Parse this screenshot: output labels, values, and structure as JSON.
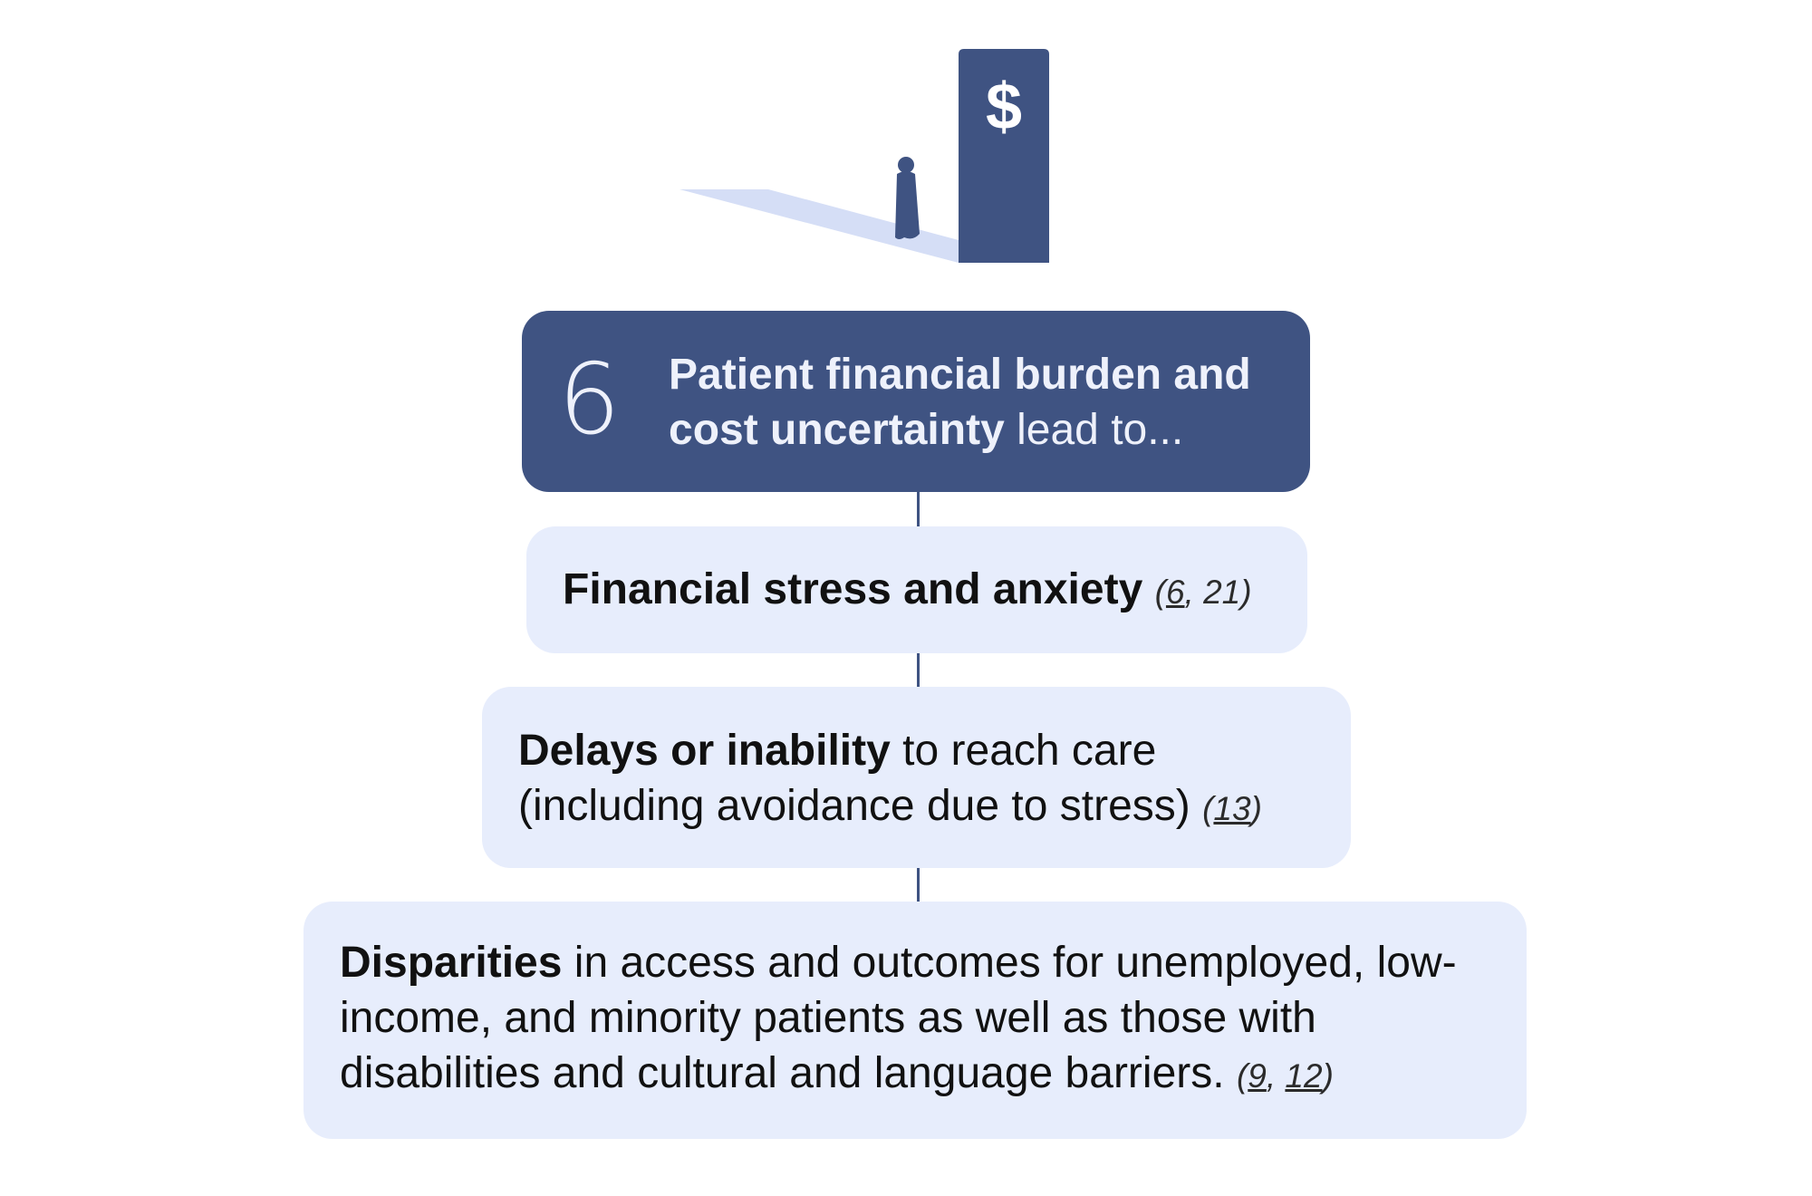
{
  "illustration": {
    "door_symbol": "$",
    "icons": [
      "open-door-icon",
      "person-silhouette-icon",
      "dollar-sign-icon"
    ],
    "colors": {
      "door": "#3f5382",
      "light": "#d5def6",
      "person": "#3f5382"
    }
  },
  "header": {
    "number": "6",
    "bold_text": "Patient financial burden and cost uncertainty",
    "normal_text": " lead to..."
  },
  "effects": [
    {
      "bold": "Financial stress and anxiety",
      "normal": "",
      "cite_open": "(",
      "refs": [
        "6",
        "21"
      ],
      "cite_close": ")"
    },
    {
      "bold": "Delays or inability",
      "normal": " to reach care (including avoidance due to stress)",
      "cite_open": "(",
      "refs": [
        "13"
      ],
      "cite_close": ")"
    },
    {
      "bold": "Disparities",
      "normal": " in access and outcomes for unemployed, low-income, and minority patients as well as those with disabilities and cultural and language barriers.",
      "cite_open": "(",
      "refs": [
        "9",
        "12"
      ],
      "cite_close": ")"
    }
  ],
  "colors": {
    "primary": "#3f5382",
    "box_fill": "#e7edfc",
    "header_text": "#eef1fb"
  }
}
